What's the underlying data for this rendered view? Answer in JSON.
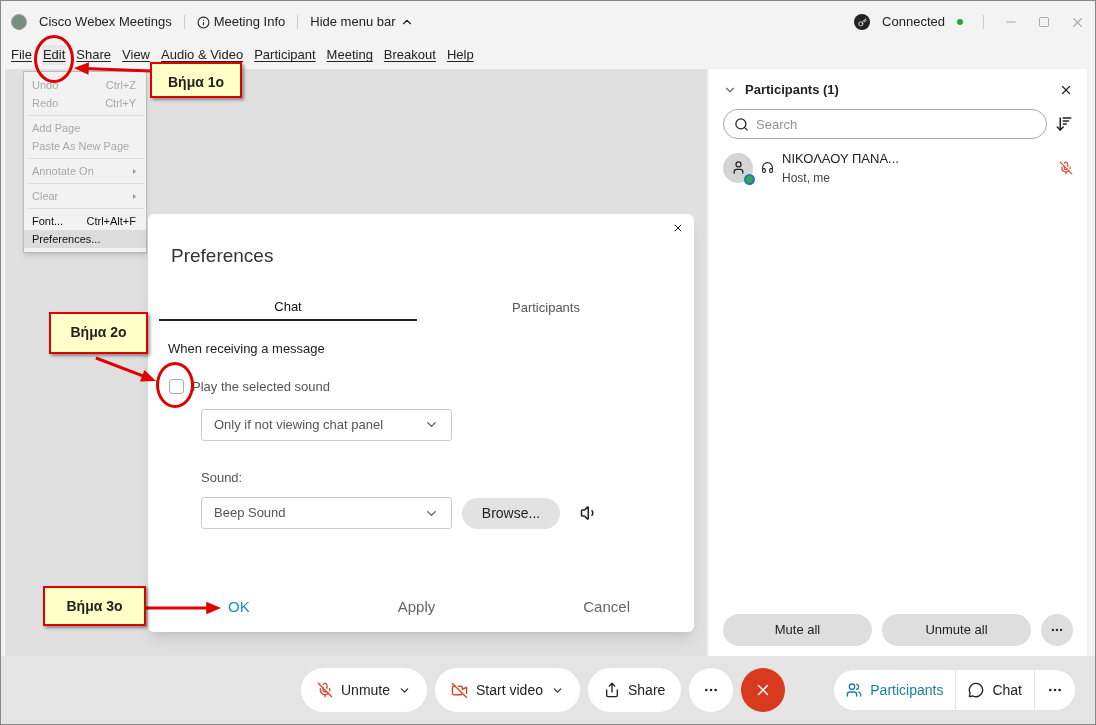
{
  "title_bar": {
    "app_name": "Cisco Webex Meetings",
    "meeting_info": "Meeting Info",
    "hide_menu": "Hide menu bar",
    "status": "Connected"
  },
  "menu": [
    {
      "label": "File",
      "selected": false
    },
    {
      "label": "Edit",
      "selected": true
    },
    {
      "label": "Share",
      "selected": false
    },
    {
      "label": "View",
      "selected": false
    },
    {
      "label": "Audio & Video",
      "selected": false
    },
    {
      "label": "Participant",
      "selected": false
    },
    {
      "label": "Meeting",
      "selected": false
    },
    {
      "label": "Breakout",
      "selected": false
    },
    {
      "label": "Help",
      "selected": false
    }
  ],
  "edit_menu": [
    {
      "kind": "item",
      "label": "Undo",
      "shortcut": "Ctrl+Z",
      "disabled": true,
      "selected": false
    },
    {
      "kind": "item",
      "label": "Redo",
      "shortcut": "Ctrl+Y",
      "disabled": true,
      "selected": false
    },
    {
      "kind": "separator"
    },
    {
      "kind": "item",
      "label": "Add Page",
      "disabled": true,
      "selected": false
    },
    {
      "kind": "item",
      "label": "Paste As New Page",
      "disabled": true,
      "selected": false
    },
    {
      "kind": "separator"
    },
    {
      "kind": "submenu",
      "label": "Annotate On",
      "disabled": true,
      "selected": false
    },
    {
      "kind": "separator"
    },
    {
      "kind": "submenu",
      "label": "Clear",
      "disabled": true,
      "selected": false
    },
    {
      "kind": "separator"
    },
    {
      "kind": "item",
      "label": "Font...",
      "shortcut": "Ctrl+Alt+F",
      "disabled": false,
      "selected": false
    },
    {
      "kind": "item",
      "label": "Preferences...",
      "disabled": false,
      "selected": true
    }
  ],
  "dialog": {
    "title": "Preferences",
    "tabs": [
      {
        "label": "Chat",
        "selected": true
      },
      {
        "label": "Participants",
        "selected": false
      }
    ],
    "section": "When receiving a message",
    "checkbox": {
      "label": "Play the selected sound",
      "checked": false
    },
    "when_select": "Only if not viewing chat panel",
    "sound_label": "Sound:",
    "sound_select": "Beep Sound",
    "browse": "Browse...",
    "buttons": [
      {
        "label": "OK",
        "kind": "primary"
      },
      {
        "label": "Apply",
        "kind": "normal"
      },
      {
        "label": "Cancel",
        "kind": "normal"
      }
    ]
  },
  "callouts": [
    {
      "text": "Βήμα 1ο"
    },
    {
      "text": "Βήμα 2ο"
    },
    {
      "text": "Βήμα 3ο"
    }
  ],
  "participants_panel": {
    "title": "Participants (1)",
    "search_placeholder": "Search",
    "people": [
      {
        "name": "ΝΙΚΟΛΑΟΥ ΠΑΝΑ...",
        "role": "Host, me",
        "muted": true
      }
    ],
    "buttons": [
      "Mute all",
      "Unmute all"
    ]
  },
  "toolbar": {
    "unmute": "Unmute",
    "video": "Start video",
    "share": "Share",
    "participants": "Participants",
    "chat": "Chat"
  }
}
